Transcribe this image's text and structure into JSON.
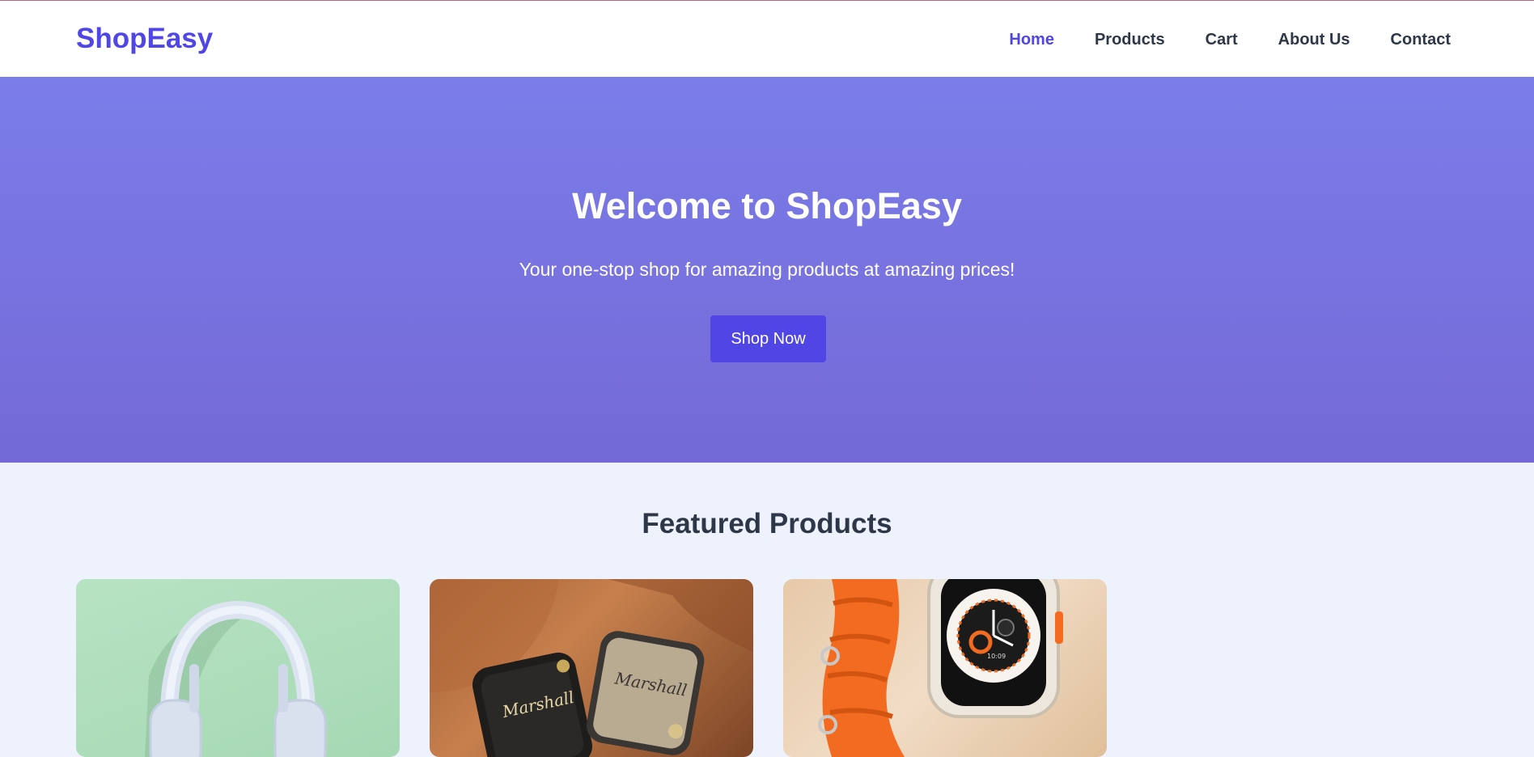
{
  "brand": {
    "name": "ShopEasy",
    "color": "#4f46e5"
  },
  "nav": {
    "items": [
      {
        "label": "Home",
        "active": true
      },
      {
        "label": "Products",
        "active": false
      },
      {
        "label": "Cart",
        "active": false
      },
      {
        "label": "About Us",
        "active": false
      },
      {
        "label": "Contact",
        "active": false
      }
    ]
  },
  "hero": {
    "title": "Welcome to ShopEasy",
    "subtitle": "Your one-stop shop for amazing products at amazing prices!",
    "cta_label": "Shop Now"
  },
  "featured": {
    "title": "Featured Products",
    "products": [
      {
        "image": "headphones-image"
      },
      {
        "image": "speakers-image"
      },
      {
        "image": "smartwatch-image"
      }
    ]
  },
  "colors": {
    "accent": "#4f46e5",
    "hero_gradient_top": "#7b7dea",
    "hero_gradient_bottom": "#7469d6",
    "page_background": "#eef2fd",
    "nav_text": "#2d3748"
  }
}
